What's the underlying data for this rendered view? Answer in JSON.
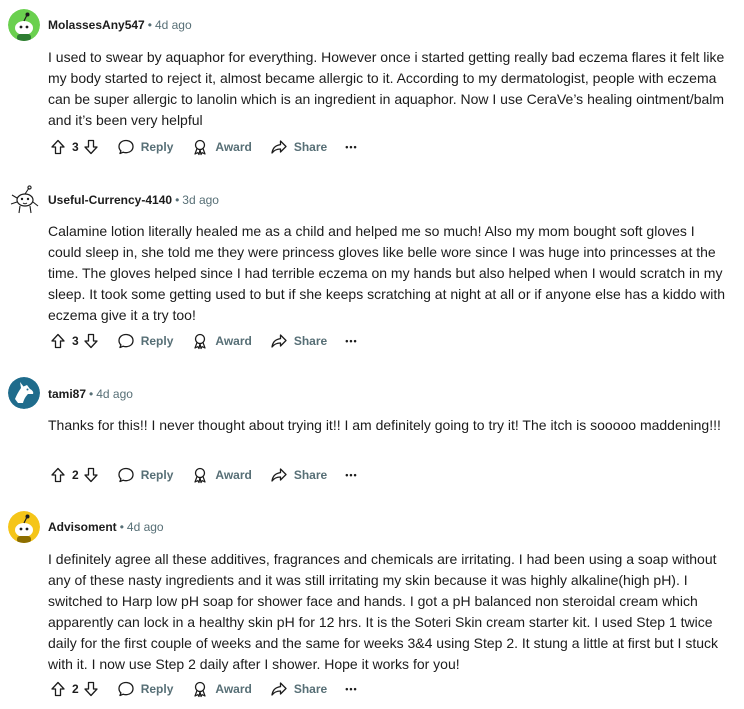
{
  "comments": [
    {
      "username": "MolassesAny547",
      "time": "4d ago",
      "avatar_color": "#6ad04f",
      "body": "I used to swear by aquaphor for everything. However once i started getting really bad eczema flares it felt like my body started to reject it, almost became allergic to it. According to my dermatologist, people with eczema can be super allergic to lanolin which is an ingredient in aquaphor. Now I use CeraVe’s healing ointment/balm and it’s been very helpful",
      "votes": "3",
      "reply": "Reply",
      "award": "Award",
      "share": "Share",
      "more": "•••"
    },
    {
      "username": "Useful-Currency-4140",
      "time": "3d ago",
      "avatar_color": "#ffffff",
      "body": "Calamine lotion literally healed me as a child and helped me so much! Also my mom bought soft gloves I could sleep in, she told me they were princess gloves like belle wore since I was huge into princesses at the time. The gloves helped since I had terrible eczema on my hands but also helped when I would scratch in my sleep. It took some getting used to but if she keeps scratching at night at all or if anyone else has a kiddo with eczema give it a try too!",
      "votes": "3",
      "reply": "Reply",
      "award": "Award",
      "share": "Share",
      "more": "•••"
    },
    {
      "username": "tami87",
      "time": "4d ago",
      "avatar_color": "#1f6c8c",
      "body": "Thanks for this!! I never thought about trying it!! I am definitely going to try it! The itch is sooooo maddening!!!",
      "votes": "2",
      "reply": "Reply",
      "award": "Award",
      "share": "Share",
      "more": "•••"
    },
    {
      "username": "Advisoment",
      "time": "4d ago",
      "avatar_color": "#f5c518",
      "body": "I definitely agree all these additives, fragrances and chemicals are irritating. I had been using a soap without any of these nasty ingredients and it was still irritating my skin because it was highly alkaline(high pH). I switched to Harp low pH soap for shower face and hands. I got a pH balanced non steroidal cream which apparently can lock in a healthy skin pH for 12 hrs. It is the Soteri Skin cream starter kit. I used Step 1 twice daily for the first couple of weeks and the same for weeks 3&4 using Step 2. It stung a little at first but I stuck with it. I now use Step 2 daily after I shower. Hope it works for you!",
      "votes": "2",
      "reply": "Reply",
      "award": "Award",
      "share": "Share",
      "more": "•••"
    }
  ]
}
